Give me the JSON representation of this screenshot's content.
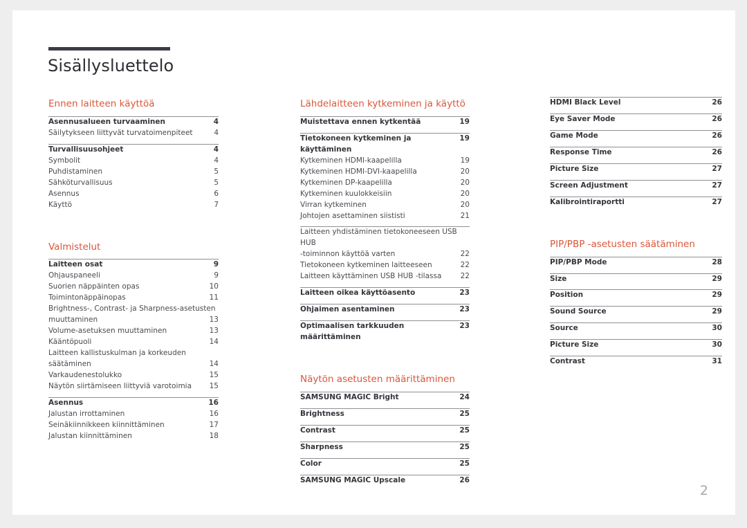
{
  "document": {
    "title": "Sisällysluettelo",
    "page_number": "2",
    "accent_color": "#d9563a",
    "rule_color": "#3c3b46",
    "page_background": "#ffffff",
    "canvas_background": "#eeeeee"
  },
  "columns": [
    {
      "id": "column-1",
      "sections": [
        {
          "heading": "Ennen laitteen käyttöä",
          "groups": [
            {
              "rule": "thick",
              "rows": [
                {
                  "label": "Asennusalueen turvaaminen",
                  "page": "4",
                  "bold": true
                },
                {
                  "label": "Säilytykseen liittyvät turvatoimenpiteet",
                  "page": "4",
                  "bold": false
                }
              ]
            },
            {
              "rule": "thick",
              "rows": [
                {
                  "label": "Turvallisuusohjeet",
                  "page": "4",
                  "bold": true
                },
                {
                  "label": "Symbolit",
                  "page": "4",
                  "bold": false
                },
                {
                  "label": "Puhdistaminen",
                  "page": "5",
                  "bold": false
                },
                {
                  "label": "Sähköturvallisuus",
                  "page": "5",
                  "bold": false
                },
                {
                  "label": "Asennus",
                  "page": "6",
                  "bold": false
                },
                {
                  "label": "Käyttö",
                  "page": "7",
                  "bold": false
                }
              ]
            }
          ]
        },
        {
          "heading": "Valmistelut",
          "groups": [
            {
              "rule": "thick",
              "rows": [
                {
                  "label": "Laitteen osat",
                  "page": "9",
                  "bold": true
                },
                {
                  "label": "Ohjauspaneeli",
                  "page": "9",
                  "bold": false
                },
                {
                  "label": "Suorien näppäinten opas",
                  "page": "10",
                  "bold": false
                },
                {
                  "label": "Toimintonäppäinopas",
                  "page": "11",
                  "bold": false
                },
                {
                  "label": "Brightness-, Contrast- ja Sharpness-asetusten",
                  "label2": "muuttaminen",
                  "page": "13",
                  "bold": false,
                  "wrap": true
                },
                {
                  "label": "Volume-asetuksen muuttaminen",
                  "page": "13",
                  "bold": false
                },
                {
                  "label": "Kääntöpuoli",
                  "page": "14",
                  "bold": false
                },
                {
                  "label": "Laitteen kallistuskulman ja korkeuden",
                  "label2": "säätäminen",
                  "page": "14",
                  "bold": false,
                  "wrap": true
                },
                {
                  "label": "Varkaudenestolukko",
                  "page": "15",
                  "bold": false
                },
                {
                  "label": "Näytön siirtämiseen liittyviä varotoimia",
                  "page": "15",
                  "bold": false
                }
              ]
            },
            {
              "rule": "thick",
              "rows": [
                {
                  "label": "Asennus",
                  "page": "16",
                  "bold": true
                },
                {
                  "label": "Jalustan irrottaminen",
                  "page": "16",
                  "bold": false
                },
                {
                  "label": "Seinäkiinnikkeen kiinnittäminen",
                  "page": "17",
                  "bold": false
                },
                {
                  "label": "Jalustan kiinnittäminen",
                  "page": "18",
                  "bold": false
                }
              ]
            }
          ]
        }
      ]
    },
    {
      "id": "column-2",
      "sections": [
        {
          "heading": "Lähdelaitteen kytkeminen ja käyttö",
          "groups": [
            {
              "rule": "thick",
              "rows": [
                {
                  "label": "Muistettava ennen kytkentää",
                  "page": "19",
                  "bold": true
                }
              ]
            },
            {
              "rule": "thick",
              "rows": [
                {
                  "label": "Tietokoneen kytkeminen ja käyttäminen",
                  "page": "19",
                  "bold": true
                },
                {
                  "label": "Kytkeminen HDMI-kaapelilla",
                  "page": "19",
                  "bold": false
                },
                {
                  "label": "Kytkeminen HDMI-DVI-kaapelilla",
                  "page": "20",
                  "bold": false
                },
                {
                  "label": "Kytkeminen DP-kaapelilla",
                  "page": "20",
                  "bold": false
                },
                {
                  "label": "Kytkeminen kuulokkeisiin",
                  "page": "20",
                  "bold": false
                },
                {
                  "label": "Virran kytkeminen",
                  "page": "20",
                  "bold": false
                },
                {
                  "label": "Johtojen asettaminen siististi",
                  "page": "21",
                  "bold": false
                }
              ]
            },
            {
              "rule": "thick",
              "rows": [
                {
                  "label": "Laitteen yhdistäminen tietokoneeseen USB HUB",
                  "label2": "-toiminnon käyttöä varten",
                  "page": "22",
                  "bold": false,
                  "wrap": true
                },
                {
                  "label": "Tietokoneen kytkeminen laitteeseen",
                  "page": "22",
                  "bold": false
                },
                {
                  "label": "Laitteen käyttäminen USB HUB -tilassa",
                  "page": "22",
                  "bold": false
                }
              ]
            },
            {
              "rule": "thick",
              "rows": [
                {
                  "label": "Laitteen oikea käyttöasento",
                  "page": "23",
                  "bold": true
                }
              ]
            },
            {
              "rule": "thick",
              "rows": [
                {
                  "label": "Ohjaimen asentaminen",
                  "page": "23",
                  "bold": true
                }
              ]
            },
            {
              "rule": "thick",
              "rows": [
                {
                  "label": "Optimaalisen tarkkuuden määrittäminen",
                  "page": "23",
                  "bold": true
                }
              ]
            }
          ]
        },
        {
          "heading": "Näytön asetusten määrittäminen",
          "groups": [
            {
              "rule": "thick",
              "rows": [
                {
                  "label": "SAMSUNG MAGIC Bright",
                  "page": "24",
                  "bold": true
                }
              ]
            },
            {
              "rule": "thick",
              "rows": [
                {
                  "label": "Brightness",
                  "page": "25",
                  "bold": true
                }
              ]
            },
            {
              "rule": "thick",
              "rows": [
                {
                  "label": "Contrast",
                  "page": "25",
                  "bold": true
                }
              ]
            },
            {
              "rule": "thick",
              "rows": [
                {
                  "label": "Sharpness",
                  "page": "25",
                  "bold": true
                }
              ]
            },
            {
              "rule": "thick",
              "rows": [
                {
                  "label": "Color",
                  "page": "25",
                  "bold": true
                }
              ]
            },
            {
              "rule": "thick",
              "rows": [
                {
                  "label": "SAMSUNG MAGIC Upscale",
                  "page": "26",
                  "bold": true
                }
              ]
            }
          ]
        }
      ]
    },
    {
      "id": "column-3",
      "sections": [
        {
          "heading": "",
          "groups": [
            {
              "rule": "thick",
              "rows": [
                {
                  "label": "HDMI Black Level",
                  "page": "26",
                  "bold": true
                }
              ]
            },
            {
              "rule": "thick",
              "rows": [
                {
                  "label": "Eye Saver Mode",
                  "page": "26",
                  "bold": true
                }
              ]
            },
            {
              "rule": "thick",
              "rows": [
                {
                  "label": "Game Mode",
                  "page": "26",
                  "bold": true
                }
              ]
            },
            {
              "rule": "thick",
              "rows": [
                {
                  "label": "Response Time",
                  "page": "26",
                  "bold": true
                }
              ]
            },
            {
              "rule": "thick",
              "rows": [
                {
                  "label": "Picture Size",
                  "page": "27",
                  "bold": true
                }
              ]
            },
            {
              "rule": "thick",
              "rows": [
                {
                  "label": "Screen Adjustment",
                  "page": "27",
                  "bold": true
                }
              ]
            },
            {
              "rule": "thick",
              "rows": [
                {
                  "label": "Kalibrointiraportti",
                  "page": "27",
                  "bold": true
                }
              ]
            }
          ]
        },
        {
          "heading": "PIP/PBP -asetusten säätäminen",
          "groups": [
            {
              "rule": "thick",
              "rows": [
                {
                  "label": "PIP/PBP Mode",
                  "page": "28",
                  "bold": true
                }
              ]
            },
            {
              "rule": "thick",
              "rows": [
                {
                  "label": "Size",
                  "page": "29",
                  "bold": true
                }
              ]
            },
            {
              "rule": "thick",
              "rows": [
                {
                  "label": "Position",
                  "page": "29",
                  "bold": true
                }
              ]
            },
            {
              "rule": "thick",
              "rows": [
                {
                  "label": "Sound Source",
                  "page": "29",
                  "bold": true
                }
              ]
            },
            {
              "rule": "thick",
              "rows": [
                {
                  "label": "Source",
                  "page": "30",
                  "bold": true
                }
              ]
            },
            {
              "rule": "thick",
              "rows": [
                {
                  "label": "Picture Size",
                  "page": "30",
                  "bold": true
                }
              ]
            },
            {
              "rule": "thick",
              "rows": [
                {
                  "label": "Contrast",
                  "page": "31",
                  "bold": true
                }
              ]
            }
          ]
        }
      ]
    }
  ]
}
